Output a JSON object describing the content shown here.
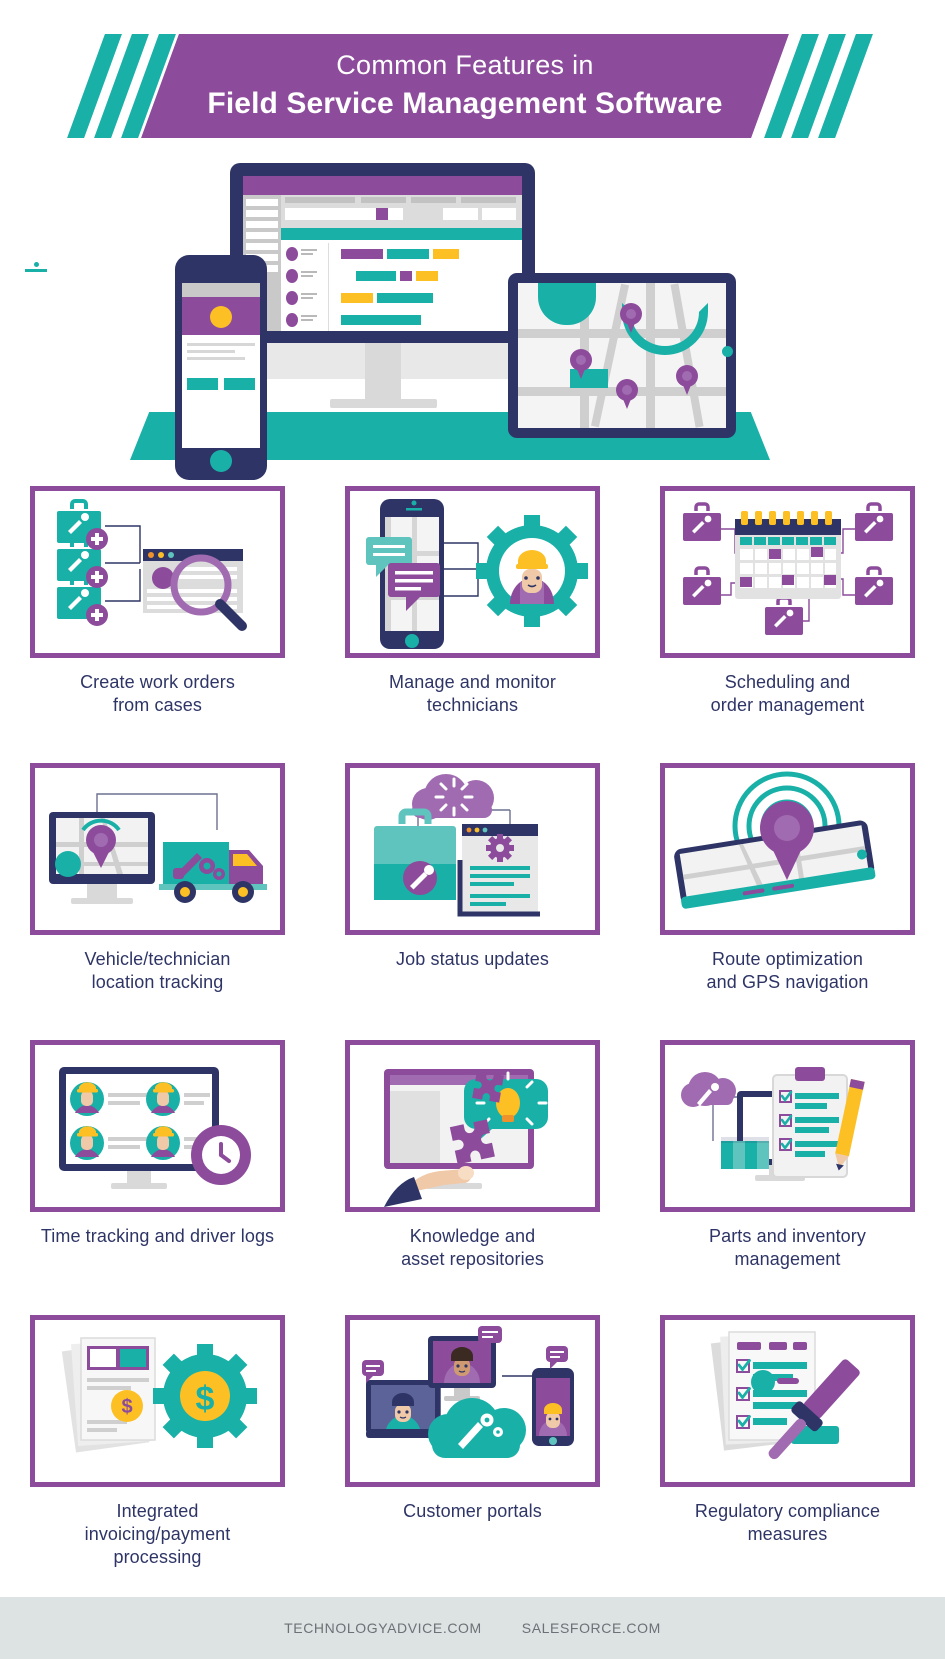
{
  "header": {
    "line1": "Common Features in",
    "line2": "Field Service Management Software",
    "bar_color": "#8c4b9b",
    "slash_color": "#19b0a8",
    "text_color": "#ffffff"
  },
  "palette": {
    "purple": "#8c4b9b",
    "purple_light": "#a06bb0",
    "teal": "#19b0a8",
    "teal_light": "#5ec4bd",
    "navy": "#2e3566",
    "yellow": "#fcc025",
    "grey": "#c9c9c9",
    "label_text": "#2e3566",
    "footer_bg": "#dde3e3",
    "footer_text": "#6b7176"
  },
  "hero": {
    "name": "field-service-devices-illustration",
    "devices": [
      "desktop-monitor",
      "smartphone",
      "tablet-map"
    ]
  },
  "cards": [
    {
      "label_line1": "Create work orders",
      "label_line2": "from cases",
      "icon": "work-orders-toolboxes-browser-search-icon"
    },
    {
      "label_line1": "Manage and monitor",
      "label_line2": "technicians",
      "icon": "phone-chat-technician-gear-icon"
    },
    {
      "label_line1": "Scheduling and",
      "label_line2": "order management",
      "icon": "calendar-toolboxes-icon"
    },
    {
      "label_line1": "Vehicle/technician",
      "label_line2": "location tracking",
      "icon": "monitor-map-pin-service-truck-icon"
    },
    {
      "label_line1": "Job status updates",
      "label_line2": "",
      "icon": "cloud-toolbox-browser-gear-icon"
    },
    {
      "label_line1": "Route optimization",
      "label_line2": "and GPS navigation",
      "icon": "gps-pin-signal-tablet-icon"
    },
    {
      "label_line1": "Time tracking and driver logs",
      "label_line2": "",
      "icon": "monitor-technician-avatars-clock-icon"
    },
    {
      "label_line1": "Knowledge and",
      "label_line2": "asset repositories",
      "icon": "monitor-hand-puzzle-lightbulb-icon"
    },
    {
      "label_line1": "Parts and inventory",
      "label_line2": "management",
      "icon": "clipboard-checklist-pencil-parts-icon"
    },
    {
      "label_line1": "Integrated",
      "label_line2": "invoicing/payment",
      "label_line3": "processing",
      "icon": "invoice-documents-dollar-gear-icon"
    },
    {
      "label_line1": "Customer portals",
      "label_line2": "",
      "icon": "customer-avatars-service-cloud-icon"
    },
    {
      "label_line1": "Regulatory compliance",
      "label_line2": "measures",
      "icon": "compliance-checklist-gavel-icon"
    }
  ],
  "footer": {
    "source1": "TECHNOLOGYADVICE.COM",
    "source2": "SALESFORCE.COM"
  }
}
